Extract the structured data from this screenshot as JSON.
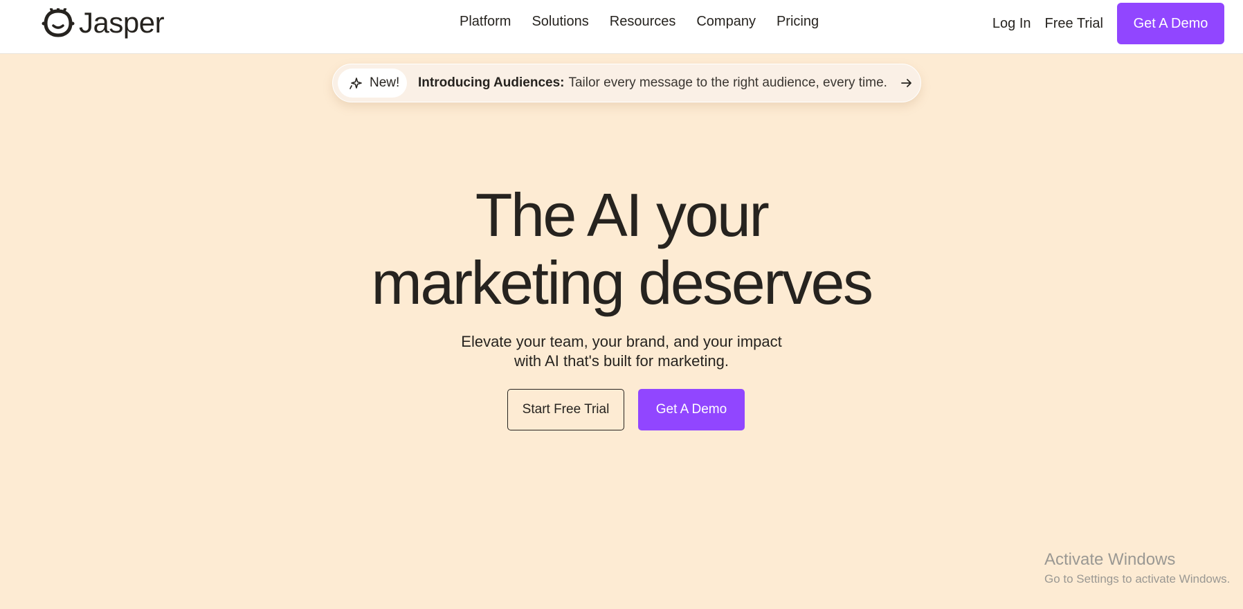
{
  "header": {
    "brand": "Jasper",
    "nav": [
      "Platform",
      "Solutions",
      "Resources",
      "Company",
      "Pricing"
    ],
    "login": "Log In",
    "free_trial": "Free Trial",
    "demo": "Get A Demo"
  },
  "announcement": {
    "badge": "New!",
    "title": "Introducing Audiences:",
    "body": "Tailor every message to the right audience, every time."
  },
  "hero": {
    "title_line1": "The AI your",
    "title_line2": "marketing deserves",
    "subtitle_line1": "Elevate your team, your brand, and your impact",
    "subtitle_line2": "with AI that's built for marketing.",
    "cta_trial": "Start Free Trial",
    "cta_demo": "Get A Demo"
  },
  "watermark": {
    "title": "Activate Windows",
    "subtitle": "Go to Settings to activate Windows."
  },
  "colors": {
    "accent": "#9146ff",
    "background": "#fdebd3",
    "text": "#26231f"
  }
}
